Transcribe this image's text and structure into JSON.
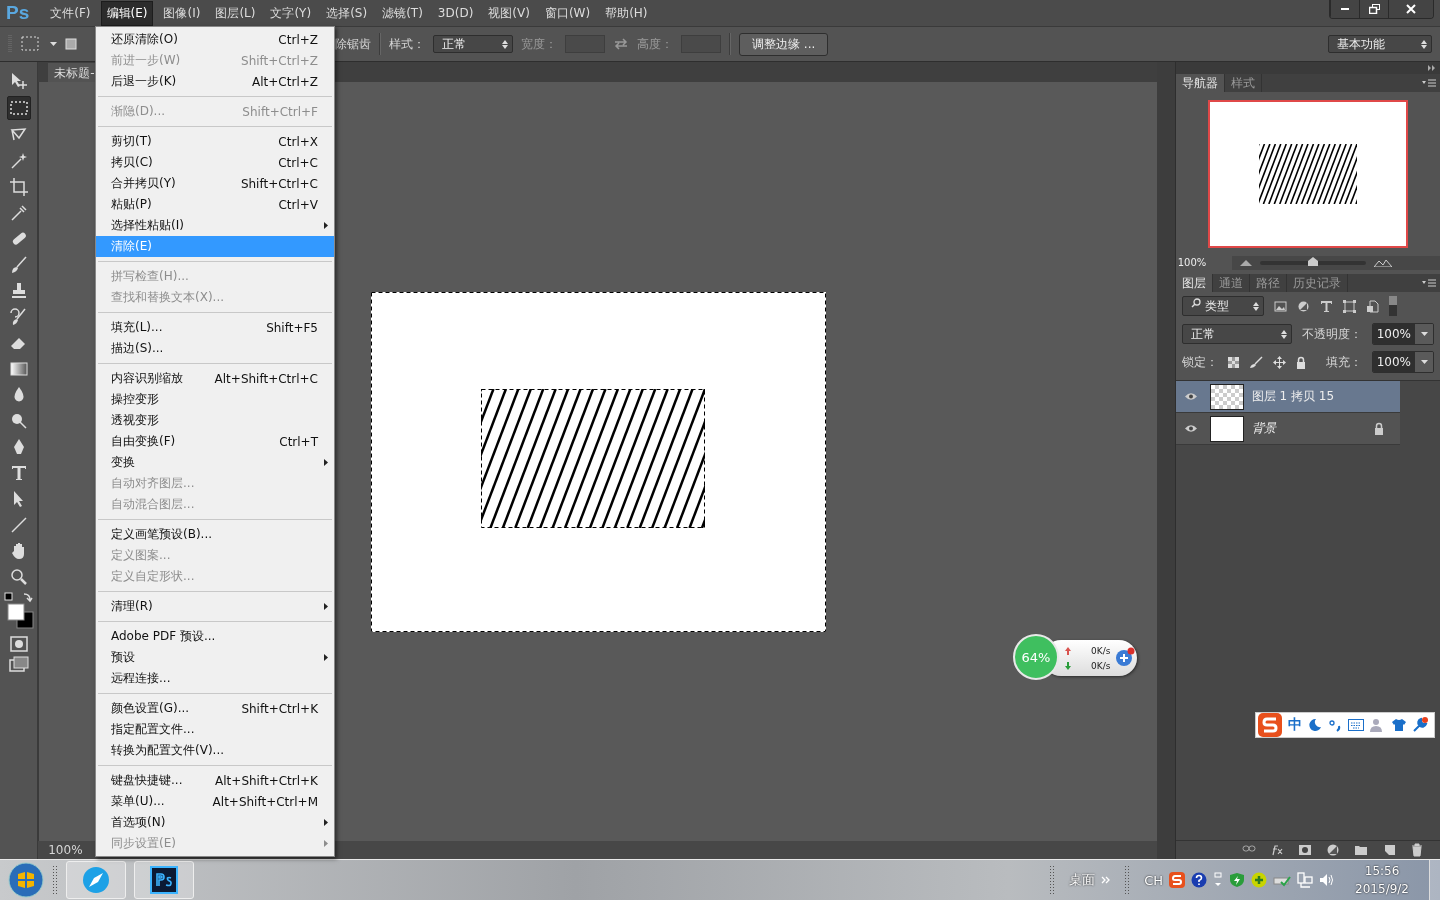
{
  "app_logo": "Ps",
  "menu_bar": [
    {
      "label": "文件(F)",
      "selected": false
    },
    {
      "label": "编辑(E)",
      "selected": true
    },
    {
      "label": "图像(I)",
      "selected": false
    },
    {
      "label": "图层(L)",
      "selected": false
    },
    {
      "label": "文字(Y)",
      "selected": false
    },
    {
      "label": "选择(S)",
      "selected": false
    },
    {
      "label": "滤镜(T)",
      "selected": false
    },
    {
      "label": "3D(D)",
      "selected": false
    },
    {
      "label": "视图(V)",
      "selected": false
    },
    {
      "label": "窗口(W)",
      "selected": false
    },
    {
      "label": "帮助(H)",
      "selected": false
    }
  ],
  "options_bar": {
    "antialias_label": "除锯齿",
    "style_label": "样式：",
    "style_value": "正常",
    "width_label": "宽度：",
    "height_label": "高度：",
    "refine_button": "调整边缘 ...",
    "workspace": "基本功能"
  },
  "document": {
    "tab_title": "未标题-",
    "zoom": "100%"
  },
  "tools": [
    {
      "selected": false
    },
    {
      "selected": true
    },
    {
      "selected": false
    },
    {
      "selected": false
    },
    {
      "selected": false
    },
    {
      "selected": false
    },
    {
      "selected": false
    },
    {
      "selected": false
    },
    {
      "selected": false
    },
    {
      "selected": false
    },
    {
      "selected": false
    },
    {
      "selected": false
    },
    {
      "selected": false
    },
    {
      "selected": false
    },
    {
      "selected": false
    },
    {
      "selected": false
    },
    {
      "selected": false
    },
    {
      "selected": false
    },
    {
      "selected": false
    },
    {
      "selected": false
    }
  ],
  "edit_menu": {
    "groups": [
      [
        {
          "label": "还原清除(O)",
          "shortcut": "Ctrl+Z",
          "disabled": false,
          "selected": false,
          "submenu": false
        },
        {
          "label": "前进一步(W)",
          "shortcut": "Shift+Ctrl+Z",
          "disabled": true,
          "selected": false,
          "submenu": false
        },
        {
          "label": "后退一步(K)",
          "shortcut": "Alt+Ctrl+Z",
          "disabled": false,
          "selected": false,
          "submenu": false
        }
      ],
      [
        {
          "label": "渐隐(D)...",
          "shortcut": "Shift+Ctrl+F",
          "disabled": true,
          "selected": false,
          "submenu": false
        }
      ],
      [
        {
          "label": "剪切(T)",
          "shortcut": "Ctrl+X",
          "disabled": false,
          "selected": false,
          "submenu": false
        },
        {
          "label": "拷贝(C)",
          "shortcut": "Ctrl+C",
          "disabled": false,
          "selected": false,
          "submenu": false
        },
        {
          "label": "合并拷贝(Y)",
          "shortcut": "Shift+Ctrl+C",
          "disabled": false,
          "selected": false,
          "submenu": false
        },
        {
          "label": "粘贴(P)",
          "shortcut": "Ctrl+V",
          "disabled": false,
          "selected": false,
          "submenu": false
        },
        {
          "label": "选择性粘贴(I)",
          "disabled": false,
          "selected": false,
          "submenu": true
        },
        {
          "label": "清除(E)",
          "disabled": false,
          "selected": true,
          "submenu": false
        }
      ],
      [
        {
          "label": "拼写检查(H)...",
          "disabled": true,
          "selected": false,
          "submenu": false
        },
        {
          "label": "查找和替换文本(X)...",
          "disabled": true,
          "selected": false,
          "submenu": false
        }
      ],
      [
        {
          "label": "填充(L)...",
          "shortcut": "Shift+F5",
          "disabled": false,
          "selected": false,
          "submenu": false
        },
        {
          "label": "描边(S)...",
          "disabled": false,
          "selected": false,
          "submenu": false
        }
      ],
      [
        {
          "label": "内容识别缩放",
          "shortcut": "Alt+Shift+Ctrl+C",
          "disabled": false,
          "selected": false,
          "submenu": false
        },
        {
          "label": "操控变形",
          "disabled": false,
          "selected": false,
          "submenu": false
        },
        {
          "label": "透视变形",
          "disabled": false,
          "selected": false,
          "submenu": false
        },
        {
          "label": "自由变换(F)",
          "shortcut": "Ctrl+T",
          "disabled": false,
          "selected": false,
          "submenu": false
        },
        {
          "label": "变换",
          "disabled": false,
          "selected": false,
          "submenu": true
        },
        {
          "label": "自动对齐图层...",
          "disabled": true,
          "selected": false,
          "submenu": false
        },
        {
          "label": "自动混合图层...",
          "disabled": true,
          "selected": false,
          "submenu": false
        }
      ],
      [
        {
          "label": "定义画笔预设(B)...",
          "disabled": false,
          "selected": false,
          "submenu": false
        },
        {
          "label": "定义图案...",
          "disabled": true,
          "selected": false,
          "submenu": false
        },
        {
          "label": "定义自定形状...",
          "disabled": true,
          "selected": false,
          "submenu": false
        }
      ],
      [
        {
          "label": "清理(R)",
          "disabled": false,
          "selected": false,
          "submenu": true
        }
      ],
      [
        {
          "label": "Adobe PDF 预设...",
          "disabled": false,
          "selected": false,
          "submenu": false
        },
        {
          "label": "预设",
          "disabled": false,
          "selected": false,
          "submenu": true
        },
        {
          "label": "远程连接...",
          "disabled": false,
          "selected": false,
          "submenu": false
        }
      ],
      [
        {
          "label": "颜色设置(G)...",
          "shortcut": "Shift+Ctrl+K",
          "disabled": false,
          "selected": false,
          "submenu": false
        },
        {
          "label": "指定配置文件...",
          "disabled": false,
          "selected": false,
          "submenu": false
        },
        {
          "label": "转换为配置文件(V)...",
          "disabled": false,
          "selected": false,
          "submenu": false
        }
      ],
      [
        {
          "label": "键盘快捷键...",
          "shortcut": "Alt+Shift+Ctrl+K",
          "disabled": false,
          "selected": false,
          "submenu": false
        },
        {
          "label": "菜单(U)...",
          "shortcut": "Alt+Shift+Ctrl+M",
          "disabled": false,
          "selected": false,
          "submenu": false
        },
        {
          "label": "首选项(N)",
          "disabled": false,
          "selected": false,
          "submenu": true
        },
        {
          "label": "同步设置(E)",
          "disabled": true,
          "selected": false,
          "submenu": true
        }
      ]
    ]
  },
  "navigator": {
    "tabs": [
      {
        "label": "导航器",
        "selected": true
      },
      {
        "label": "样式",
        "selected": false
      }
    ],
    "zoom": "100%",
    "level": 0.5
  },
  "layers_panel": {
    "tabs": [
      {
        "label": "图层",
        "selected": true
      },
      {
        "label": "通道",
        "selected": false
      },
      {
        "label": "路径",
        "selected": false
      },
      {
        "label": "历史记录",
        "selected": false
      }
    ],
    "filter": "类型",
    "blend_mode": "正常",
    "opacity_label": "不透明度：",
    "opacity": "100%",
    "lock_label": "锁定：",
    "fill_label": "填充：",
    "fill": "100%",
    "layers": [
      {
        "name": "图层 1 拷贝 15",
        "kind": "transparent",
        "selected": true,
        "visible": true,
        "locked": false
      },
      {
        "name": "背景",
        "kind": "background",
        "selected": false,
        "visible": true,
        "locked": true
      }
    ]
  },
  "network_widget": {
    "percent": "64%",
    "upload": "0K/s",
    "download": "0K/s"
  },
  "ime_bar": {
    "mode": "中"
  },
  "taskbar": {
    "desktop_label": "桌面",
    "language": "CH",
    "time": "15:56",
    "date": "2015/9/2"
  }
}
